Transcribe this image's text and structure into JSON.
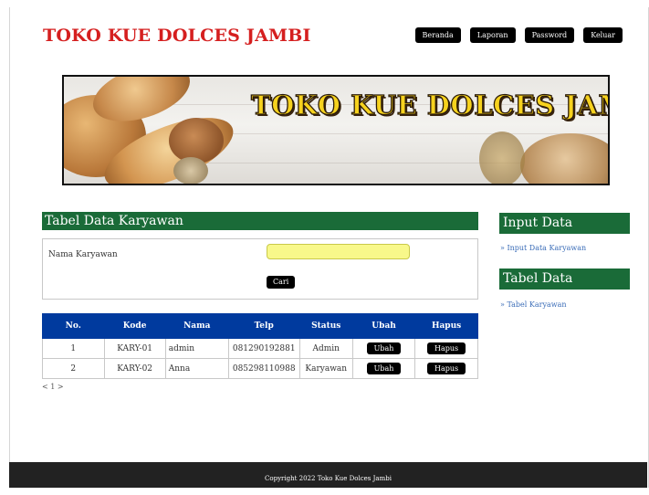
{
  "site": {
    "title": "TOKO KUE DOLCES JAMBI"
  },
  "nav": {
    "items": [
      "Beranda",
      "Laporan",
      "Password",
      "Keluar"
    ]
  },
  "banner": {
    "text": "TOKO KUE DOLCES JAMBI"
  },
  "main": {
    "section_title": "Tabel Data Karyawan",
    "search": {
      "label": "Nama Karyawan",
      "value": "",
      "button": "Cari"
    },
    "table": {
      "headers": [
        "No.",
        "Kode",
        "Nama",
        "Telp",
        "Status",
        "Ubah",
        "Hapus"
      ],
      "rows": [
        {
          "no": "1",
          "kode": "KARY-01",
          "nama": "admin",
          "telp": "081290192881",
          "status": "Admin",
          "ubah": "Ubah",
          "hapus": "Hapus"
        },
        {
          "no": "2",
          "kode": "KARY-02",
          "nama": "Anna",
          "telp": "085298110988",
          "status": "Karyawan",
          "ubah": "Ubah",
          "hapus": "Hapus"
        }
      ]
    },
    "pagination": "< 1 >"
  },
  "sidebar": {
    "sections": [
      {
        "title": "Input Data",
        "link": "» Input Data Karyawan"
      },
      {
        "title": "Tabel Data",
        "link": "» Tabel Karyawan"
      }
    ]
  },
  "footer": {
    "text": "Copyright 2022 Toko Kue Dolces Jambi"
  },
  "colors": {
    "brand_red": "#d51f1f",
    "section_green": "#1a6b38",
    "table_header_blue": "#003a9e",
    "search_yellow": "#f8f88a",
    "footer_bg": "#222222"
  }
}
